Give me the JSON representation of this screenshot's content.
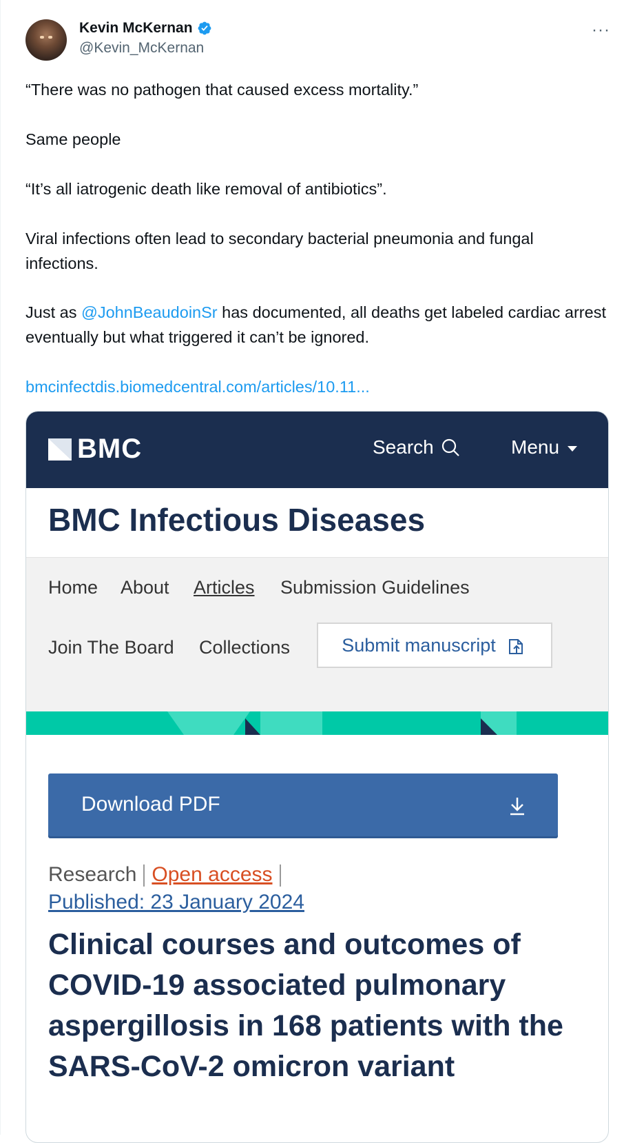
{
  "tweet": {
    "author": {
      "display_name": "Kevin McKernan",
      "handle": "@Kevin_McKernan",
      "verified": true
    },
    "more_label": "···",
    "paragraphs": {
      "p1": "“There was no pathogen that caused excess mortality.”",
      "p2": "Same people",
      "p3": "“It’s all iatrogenic death like removal of antibiotics”.",
      "p4": "Viral infections often lead to secondary bacterial pneumonia and fungal infections.",
      "p5_before": "Just as ",
      "p5_mention": "@JohnBeaudoinSr",
      "p5_after": " has documented, all deaths get labeled cardiac arrest eventually but what triggered it can’t be ignored.",
      "link": "bmcinfectdis.biomedcentral.com/articles/10.11..."
    }
  },
  "card": {
    "logo_text": "BMC",
    "search_label": "Search",
    "menu_label": "Menu",
    "journal_title": "BMC Infectious Diseases",
    "nav": {
      "home": "Home",
      "about": "About",
      "articles": "Articles",
      "submission": "Submission Guidelines",
      "join": "Join The Board",
      "collections": "Collections",
      "submit": "Submit manuscript"
    },
    "download_label": "Download PDF",
    "meta": {
      "type": "Research",
      "access": "Open access",
      "published": "Published: 23 January 2024"
    },
    "article_title": "Clinical courses and outcomes of COVID-19 associated pulmonary aspergillosis in 168 patients with the SARS-CoV-2 omicron variant"
  },
  "colors": {
    "link": "#1d9bf0",
    "bmc_navy": "#1b2e4f",
    "bmc_teal": "#00c9a7",
    "download_blue": "#3b6aa8",
    "open_access_orange": "#d84f23"
  }
}
